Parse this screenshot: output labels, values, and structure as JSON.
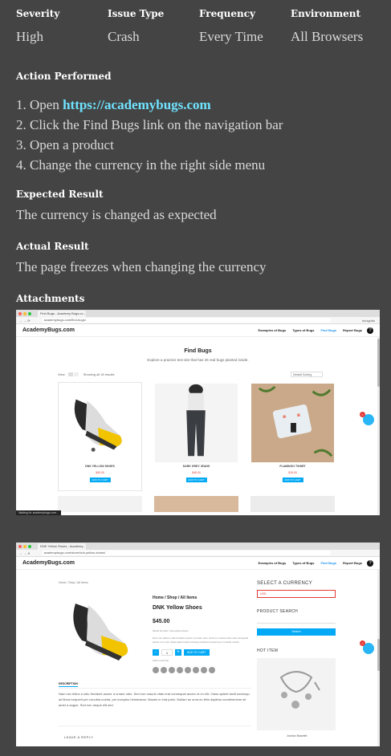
{
  "meta": {
    "columns": [
      {
        "label": "Severity",
        "value": "High"
      },
      {
        "label": "Issue Type",
        "value": "Crash"
      },
      {
        "label": "Frequency",
        "value": "Every Time"
      },
      {
        "label": "Environment",
        "value": "All Browsers"
      }
    ]
  },
  "action": {
    "heading": "Action Performed",
    "steps": [
      {
        "num": "1.",
        "text": "Open ",
        "link": "https://academybugs.com"
      },
      {
        "num": "2.",
        "text": "Click the Find Bugs link on the navigation bar"
      },
      {
        "num": "3.",
        "text": "Open a product"
      },
      {
        "num": "4.",
        "text": "Change the currency in the right side menu"
      }
    ]
  },
  "expected": {
    "heading": "Expected Result",
    "text": "The currency is changed as expected"
  },
  "actual": {
    "heading": "Actual Result",
    "text": "The page freezes when changing the currency"
  },
  "attachments": {
    "heading": "Attachments"
  },
  "shot1": {
    "tab_title": "Find Bugs - Academy Bugs.co...",
    "url": "academybugs.com/find-bugs/",
    "profile": "Incognito",
    "logo": "AcademyBugs.com",
    "nav": [
      "Examples of Bugs",
      "Types of Bugs",
      "Find Bugs",
      "Report Bugs"
    ],
    "title": "Find Bugs",
    "subtitle": "Explore a practice test site that has 25 real bugs planted inside.",
    "view_label": "View",
    "showing": "Showing all 18 results",
    "sort": "Default Sorting",
    "products": [
      {
        "name": "DNK YELLOW SHOES",
        "price": "$45.00",
        "button": "ADD TO CART"
      },
      {
        "name": "DARK GREY JEANS",
        "price": "$48.00",
        "button": "ADD TO CART"
      },
      {
        "name": "FLAMINGO TSHIRT",
        "price": "$15.00",
        "button": "ADD TO CART"
      }
    ],
    "status": "Waiting for academybugs.com..."
  },
  "shot2": {
    "tab_title": "DNK Yellow Shoes - Academy...",
    "url": "academybugs.com/store/dnk-yellow-shoes/",
    "logo": "AcademyBugs.com",
    "nav": [
      "Examples of Bugs",
      "Types of Bugs",
      "Find Bugs",
      "Report Bugs"
    ],
    "crumb": "Home / Shop / All Items",
    "product_crumb": "Home / Shop / All Items",
    "product_name": "DNK Yellow Shoes",
    "price": "$45.00",
    "sku": "Model Number: dnk-yellow-shoes",
    "short_desc": "Nam nec tellus a odio tincidunt auctor a ornare odio. Sed non mauris vitae erat consequat auctor eu in elit. Class aptent taciti sociosqu ad litora torquent per conubia nostra.",
    "qty": "1",
    "add_to_cart": "ADD TO CART",
    "wishlist": "Add to wish list",
    "tab": "DESCRIPTION",
    "description": "Nam nec tellus a odio tincidunt auctor a ornare odio. Sed non mauris vitae erat consequat auctor eu in elit. Class aptent taciti sociosqu ad litora torquent per conubia nostra, per inceptos himenaeos. Mauris in erat justo. Nullam ac urna eu felis dapibus condimentum sit amet a augue. Sed non neque elit sed.",
    "leave_reply": "LEAVE A REPLY",
    "currency_head": "SELECT A CURRENCY",
    "currency_value": "USD",
    "search_head": "PRODUCT SEARCH",
    "search_button": "Search",
    "hot_head": "HOT ITEM",
    "hot_caption": "Anchor Bracelet"
  },
  "colors": {
    "background": "#444444",
    "link": "#6fe3ff",
    "accent": "#03a9f4",
    "error": "#e53935"
  }
}
